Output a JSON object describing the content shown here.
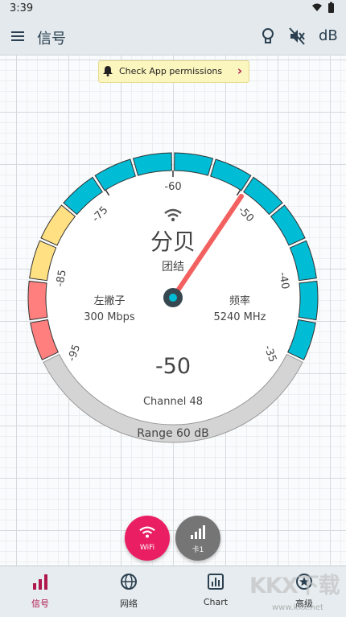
{
  "status": {
    "time": "3:39"
  },
  "appbar": {
    "title": "信号",
    "db_label": "dB",
    "icons": [
      "menu-icon",
      "lightbulb-icon",
      "mute-icon"
    ]
  },
  "banner": {
    "text": "Check App permissions",
    "icon": "bell-icon"
  },
  "gauge": {
    "ticks": [
      "-95",
      "-85",
      "-75",
      "-60",
      "-50",
      "-40",
      "-35"
    ],
    "signal_unit": "分贝",
    "ssid": "团结",
    "left_title": "左撇子",
    "left_value": "300 Mbps",
    "right_title": "频率",
    "right_value": "5240 MHz",
    "reading": "-50",
    "channel": "Channel 48",
    "range": "Range 60 dB",
    "needle_value": -50,
    "colors": {
      "cyan": "#00bcd4",
      "yellow": "#ffe082",
      "red": "#ff7f7f",
      "gray": "#d4d4d4",
      "needle": "#f2615f"
    }
  },
  "fabs": [
    {
      "label": "WiFi",
      "icon": "wifi-icon",
      "active": true
    },
    {
      "label": "卡1",
      "icon": "cell-signal-icon",
      "active": false
    }
  ],
  "nav": [
    {
      "label": "信号",
      "icon": "signal-bars-icon",
      "active": true
    },
    {
      "label": "网络",
      "icon": "globe-icon",
      "active": false
    },
    {
      "label": "Chart",
      "icon": "chart-icon",
      "active": false
    },
    {
      "label": "高级",
      "icon": "advanced-icon",
      "active": false
    }
  ],
  "watermark": {
    "text": "KKX下载",
    "url": "www.kkx.net"
  }
}
